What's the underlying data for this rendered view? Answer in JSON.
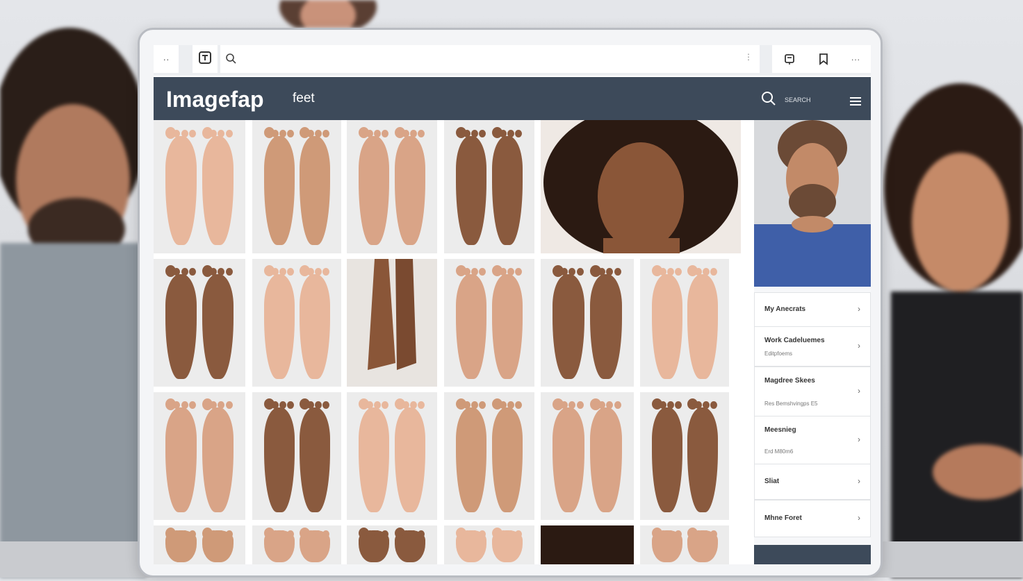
{
  "browser": {
    "dots_label": "··",
    "url_value": "",
    "more_label": "⋮",
    "overflow_label": "···"
  },
  "site": {
    "logo": "Imagefap",
    "search_query": "feet",
    "search_label": "SEARCH"
  },
  "sidebar": {
    "items": [
      {
        "title": "My Anecrats",
        "subtitle": ""
      },
      {
        "title": "Work Cadeluemes",
        "subtitle": "Editpfoems"
      },
      {
        "title": "Magdree Skees",
        "subtitle": "Res Bemshvingps E5"
      },
      {
        "title": "Meesnieg",
        "subtitle": "Erd M80m6"
      },
      {
        "title": "Sliat",
        "subtitle": ""
      },
      {
        "title": "Mhne Foret",
        "subtitle": ""
      }
    ]
  },
  "colors": {
    "header_bg": "#3d4a5a",
    "tile_bg": "#ececec",
    "skin_light": "#e8b79c",
    "skin_mid": "#cf9a78",
    "skin_dark": "#8a5a3e"
  }
}
